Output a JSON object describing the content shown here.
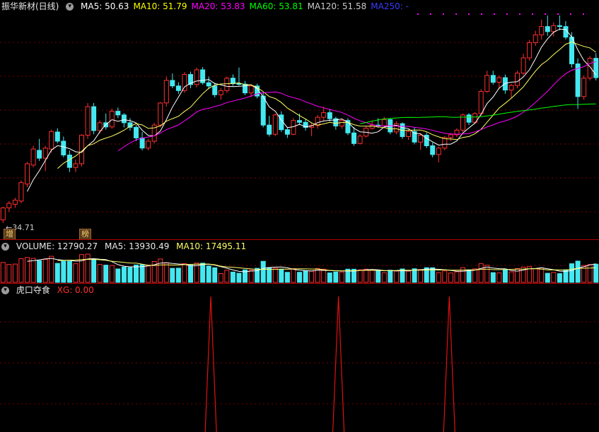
{
  "main": {
    "stock_title": "振华新材(日线)",
    "ma_items": [
      {
        "label": "MA5: 50.63",
        "color": "#ffffff"
      },
      {
        "label": "MA10: 51.79",
        "color": "#ffff00"
      },
      {
        "label": "MA20: 53.83",
        "color": "#ff00ff"
      },
      {
        "label": "MA60: 53.81",
        "color": "#00ff00"
      },
      {
        "label": "MA120: 51.58",
        "color": "#cccccc"
      },
      {
        "label": "MA250: -",
        "color": "#3a3aff"
      }
    ],
    "low_price_label": "34.71",
    "badge_left": "增",
    "badge_right": "榜"
  },
  "volume": {
    "label": "VOLUME: 12790.27",
    "ma5": "MA5: 13930.49",
    "ma10": "MA10: 17495.11"
  },
  "indicator": {
    "name": "虎口夺食",
    "xg": "XG: 0.00",
    "spike_positions": [
      0.352,
      0.565,
      0.75
    ]
  },
  "colors": {
    "up": "#ff3030",
    "down": "#44e8f0",
    "ma5": "#ffffff",
    "ma10": "#ffff66",
    "ma20": "#ff00ff",
    "ma60": "#00ff00",
    "grid": "#7a0000"
  },
  "chart_data": {
    "type": "candlestick",
    "price_range": [
      34.71,
      69.5
    ],
    "candles": [
      {
        "o": 35.4,
        "h": 38.2,
        "l": 34.71,
        "c": 38.0
      },
      {
        "o": 38.0,
        "h": 39.5,
        "l": 37.2,
        "c": 39.0
      },
      {
        "o": 38.8,
        "h": 40.2,
        "l": 38.0,
        "c": 39.7
      },
      {
        "o": 39.5,
        "h": 44.0,
        "l": 39.0,
        "c": 43.5
      },
      {
        "o": 43.2,
        "h": 48.0,
        "l": 42.5,
        "c": 47.6
      },
      {
        "o": 47.3,
        "h": 51.5,
        "l": 46.8,
        "c": 50.8
      },
      {
        "o": 50.5,
        "h": 53.0,
        "l": 48.2,
        "c": 48.8
      },
      {
        "o": 48.8,
        "h": 51.5,
        "l": 46.0,
        "c": 51.0
      },
      {
        "o": 50.8,
        "h": 55.0,
        "l": 50.0,
        "c": 54.6
      },
      {
        "o": 54.5,
        "h": 55.3,
        "l": 52.0,
        "c": 52.5
      },
      {
        "o": 52.5,
        "h": 53.5,
        "l": 49.0,
        "c": 49.5
      },
      {
        "o": 49.5,
        "h": 50.5,
        "l": 45.8,
        "c": 46.8
      },
      {
        "o": 46.8,
        "h": 48.5,
        "l": 45.8,
        "c": 47.6
      },
      {
        "o": 47.6,
        "h": 54.0,
        "l": 47.0,
        "c": 53.8
      },
      {
        "o": 53.8,
        "h": 60.8,
        "l": 53.0,
        "c": 60.0
      },
      {
        "o": 60.0,
        "h": 60.8,
        "l": 54.0,
        "c": 54.8
      },
      {
        "o": 54.8,
        "h": 57.0,
        "l": 54.2,
        "c": 56.5
      },
      {
        "o": 56.5,
        "h": 58.5,
        "l": 55.0,
        "c": 55.6
      },
      {
        "o": 55.6,
        "h": 59.6,
        "l": 55.2,
        "c": 59.0
      },
      {
        "o": 59.0,
        "h": 59.8,
        "l": 57.5,
        "c": 58.2
      },
      {
        "o": 58.2,
        "h": 58.6,
        "l": 55.5,
        "c": 56.5
      },
      {
        "o": 56.5,
        "h": 57.5,
        "l": 54.8,
        "c": 55.5
      },
      {
        "o": 55.5,
        "h": 56.0,
        "l": 52.5,
        "c": 53.2
      },
      {
        "o": 53.2,
        "h": 54.5,
        "l": 50.5,
        "c": 51.0
      },
      {
        "o": 51.0,
        "h": 53.0,
        "l": 50.5,
        "c": 52.5
      },
      {
        "o": 52.5,
        "h": 56.5,
        "l": 52.0,
        "c": 56.0
      },
      {
        "o": 56.0,
        "h": 61.0,
        "l": 55.5,
        "c": 60.8
      },
      {
        "o": 60.8,
        "h": 66.5,
        "l": 60.0,
        "c": 65.7
      },
      {
        "o": 65.7,
        "h": 67.2,
        "l": 64.0,
        "c": 64.5
      },
      {
        "o": 64.5,
        "h": 65.3,
        "l": 62.8,
        "c": 63.5
      },
      {
        "o": 63.5,
        "h": 67.5,
        "l": 63.0,
        "c": 67.0
      },
      {
        "o": 67.0,
        "h": 67.6,
        "l": 64.0,
        "c": 64.8
      },
      {
        "o": 64.8,
        "h": 68.5,
        "l": 64.2,
        "c": 68.0
      },
      {
        "o": 68.0,
        "h": 68.6,
        "l": 64.8,
        "c": 65.2
      },
      {
        "o": 65.2,
        "h": 66.5,
        "l": 63.8,
        "c": 64.5
      },
      {
        "o": 64.5,
        "h": 65.2,
        "l": 62.0,
        "c": 62.6
      },
      {
        "o": 62.6,
        "h": 64.0,
        "l": 61.5,
        "c": 63.5
      },
      {
        "o": 63.5,
        "h": 66.5,
        "l": 63.0,
        "c": 66.2
      },
      {
        "o": 66.2,
        "h": 67.0,
        "l": 64.5,
        "c": 65.0
      },
      {
        "o": 65.0,
        "h": 68.5,
        "l": 64.6,
        "c": 64.9
      },
      {
        "o": 64.9,
        "h": 65.6,
        "l": 62.5,
        "c": 63.0
      },
      {
        "o": 63.0,
        "h": 64.8,
        "l": 62.0,
        "c": 64.5
      },
      {
        "o": 64.5,
        "h": 65.0,
        "l": 61.8,
        "c": 62.3
      },
      {
        "o": 62.3,
        "h": 63.0,
        "l": 55.5,
        "c": 56.0
      },
      {
        "o": 56.0,
        "h": 58.0,
        "l": 53.5,
        "c": 54.0
      },
      {
        "o": 54.0,
        "h": 58.5,
        "l": 53.6,
        "c": 58.2
      },
      {
        "o": 58.2,
        "h": 59.0,
        "l": 54.5,
        "c": 55.0
      },
      {
        "o": 55.0,
        "h": 55.5,
        "l": 53.2,
        "c": 54.0
      },
      {
        "o": 54.0,
        "h": 57.5,
        "l": 53.8,
        "c": 57.0
      },
      {
        "o": 57.0,
        "h": 58.5,
        "l": 56.0,
        "c": 56.6
      },
      {
        "o": 56.6,
        "h": 57.3,
        "l": 54.8,
        "c": 55.5
      },
      {
        "o": 55.5,
        "h": 56.6,
        "l": 53.6,
        "c": 55.9
      },
      {
        "o": 55.9,
        "h": 58.2,
        "l": 55.2,
        "c": 57.7
      },
      {
        "o": 57.7,
        "h": 60.0,
        "l": 56.8,
        "c": 58.7
      },
      {
        "o": 58.7,
        "h": 59.5,
        "l": 56.8,
        "c": 57.4
      },
      {
        "o": 57.4,
        "h": 57.8,
        "l": 55.0,
        "c": 55.8
      },
      {
        "o": 55.8,
        "h": 57.5,
        "l": 55.2,
        "c": 57.0
      },
      {
        "o": 57.0,
        "h": 57.5,
        "l": 53.8,
        "c": 54.3
      },
      {
        "o": 54.3,
        "h": 55.6,
        "l": 51.5,
        "c": 52.0
      },
      {
        "o": 52.0,
        "h": 54.0,
        "l": 51.8,
        "c": 53.6
      },
      {
        "o": 53.6,
        "h": 55.8,
        "l": 53.3,
        "c": 55.3
      },
      {
        "o": 55.3,
        "h": 57.0,
        "l": 55.0,
        "c": 56.0
      },
      {
        "o": 56.0,
        "h": 57.5,
        "l": 55.4,
        "c": 55.8
      },
      {
        "o": 55.8,
        "h": 57.8,
        "l": 55.6,
        "c": 57.2
      },
      {
        "o": 57.2,
        "h": 57.5,
        "l": 54.0,
        "c": 54.5
      },
      {
        "o": 54.5,
        "h": 56.8,
        "l": 54.0,
        "c": 56.3
      },
      {
        "o": 56.3,
        "h": 56.6,
        "l": 53.0,
        "c": 53.5
      },
      {
        "o": 53.5,
        "h": 55.0,
        "l": 52.8,
        "c": 54.6
      },
      {
        "o": 54.6,
        "h": 55.5,
        "l": 51.8,
        "c": 52.3
      },
      {
        "o": 52.3,
        "h": 54.2,
        "l": 50.6,
        "c": 53.8
      },
      {
        "o": 53.8,
        "h": 54.4,
        "l": 51.0,
        "c": 51.5
      },
      {
        "o": 51.5,
        "h": 52.2,
        "l": 49.0,
        "c": 49.6
      },
      {
        "o": 49.6,
        "h": 51.3,
        "l": 47.9,
        "c": 51.0
      },
      {
        "o": 51.0,
        "h": 53.6,
        "l": 50.5,
        "c": 53.3
      },
      {
        "o": 53.3,
        "h": 54.3,
        "l": 52.5,
        "c": 53.9
      },
      {
        "o": 53.9,
        "h": 55.3,
        "l": 53.4,
        "c": 54.9
      },
      {
        "o": 54.9,
        "h": 58.5,
        "l": 54.5,
        "c": 58.2
      },
      {
        "o": 58.2,
        "h": 58.6,
        "l": 56.0,
        "c": 56.6
      },
      {
        "o": 56.6,
        "h": 58.8,
        "l": 56.2,
        "c": 58.5
      },
      {
        "o": 58.5,
        "h": 63.8,
        "l": 58.0,
        "c": 63.3
      },
      {
        "o": 63.3,
        "h": 67.8,
        "l": 63.0,
        "c": 66.8
      },
      {
        "o": 66.8,
        "h": 67.8,
        "l": 64.8,
        "c": 65.3
      },
      {
        "o": 65.3,
        "h": 66.8,
        "l": 63.8,
        "c": 66.3
      },
      {
        "o": 66.3,
        "h": 67.0,
        "l": 62.8,
        "c": 63.6
      },
      {
        "o": 63.6,
        "h": 65.0,
        "l": 61.8,
        "c": 64.6
      },
      {
        "o": 64.6,
        "h": 67.8,
        "l": 64.0,
        "c": 67.3
      },
      {
        "o": 67.3,
        "h": 71.5,
        "l": 66.8,
        "c": 70.6
      },
      {
        "o": 70.6,
        "h": 74.5,
        "l": 70.0,
        "c": 73.9
      },
      {
        "o": 73.9,
        "h": 76.5,
        "l": 73.2,
        "c": 75.6
      },
      {
        "o": 75.6,
        "h": 78.9,
        "l": 74.6,
        "c": 77.4
      },
      {
        "o": 77.4,
        "h": 79.8,
        "l": 75.4,
        "c": 76.3
      },
      {
        "o": 76.3,
        "h": 78.3,
        "l": 75.3,
        "c": 77.6
      },
      {
        "o": 77.6,
        "h": 79.8,
        "l": 76.6,
        "c": 77.4
      },
      {
        "o": 77.4,
        "h": 78.6,
        "l": 74.6,
        "c": 75.1
      },
      {
        "o": 75.1,
        "h": 76.2,
        "l": 68.5,
        "c": 69.3
      },
      {
        "o": 69.3,
        "h": 70.5,
        "l": 59.5,
        "c": 62.2
      },
      {
        "o": 62.2,
        "h": 66.8,
        "l": 61.5,
        "c": 66.2
      },
      {
        "o": 66.2,
        "h": 71.0,
        "l": 65.7,
        "c": 70.5
      },
      {
        "o": 70.5,
        "h": 71.6,
        "l": 65.7,
        "c": 66.3
      }
    ]
  }
}
